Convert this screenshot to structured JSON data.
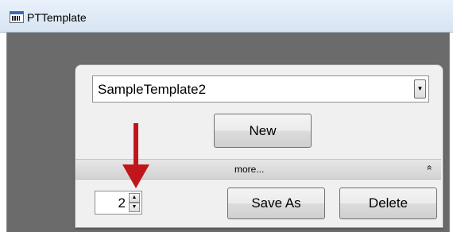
{
  "window": {
    "title": "PTTemplate",
    "icon": "app-barcode-icon"
  },
  "template_combo": {
    "selected": "SampleTemplate2",
    "dropdown_icon": "chevron-down-icon"
  },
  "buttons": {
    "new": "New",
    "save_as": "Save As",
    "delete": "Delete"
  },
  "more_bar": {
    "label": "more...",
    "icon": "double-chevron-up-icon"
  },
  "copies_spinner": {
    "value": "2"
  },
  "annotation": {
    "arrow_color": "#c0161b"
  },
  "colors": {
    "client_background": "#6b6b6b",
    "panel_background": "#f0f0f0"
  }
}
